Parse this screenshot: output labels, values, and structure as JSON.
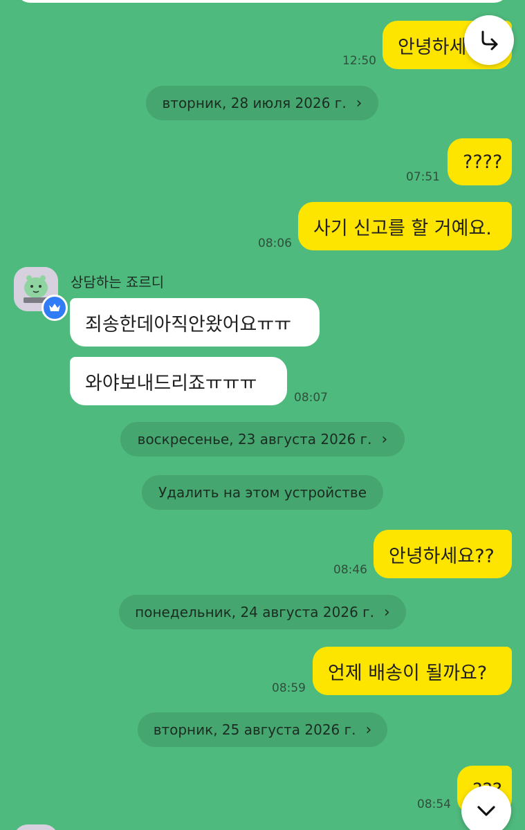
{
  "dates": {
    "d1": "вторник, 28 июля 2026 г.",
    "d2": "воскресенье, 23 августа 2026 г.",
    "d3": "понедельник, 24 августа 2026 г.",
    "d4": "вторник, 25 августа 2026 г."
  },
  "system": {
    "delete_notice": "Удалить на этом устройстве"
  },
  "sender": {
    "name": "상담하는 죠르디"
  },
  "messages": {
    "m1": {
      "text": "안녕하세",
      "time": "12:50"
    },
    "m2": {
      "text": "????",
      "time": "07:51"
    },
    "m3": {
      "text": "사기 신고를 할 거예요.",
      "time": "08:06"
    },
    "m4": {
      "text": "죄송한데아직안왔어요ㅠㅠ"
    },
    "m5": {
      "text": "와야보내드리죠ㅠㅠㅠ",
      "time": "08:07"
    },
    "m6": {
      "text": "안녕하세요??",
      "time": "08:46"
    },
    "m7": {
      "text": "언제 배송이 될까요?",
      "time": "08:59"
    },
    "m8": {
      "text": "???",
      "time": "08:54"
    }
  },
  "icons": {
    "share": "share-arrow-icon",
    "scroll_down": "chevron-down-icon",
    "badge": "crown-icon"
  },
  "colors": {
    "background": "#4fba7d",
    "outgoing_bubble": "#fee500",
    "incoming_bubble": "#ffffff",
    "badge": "#2f7cf6"
  }
}
